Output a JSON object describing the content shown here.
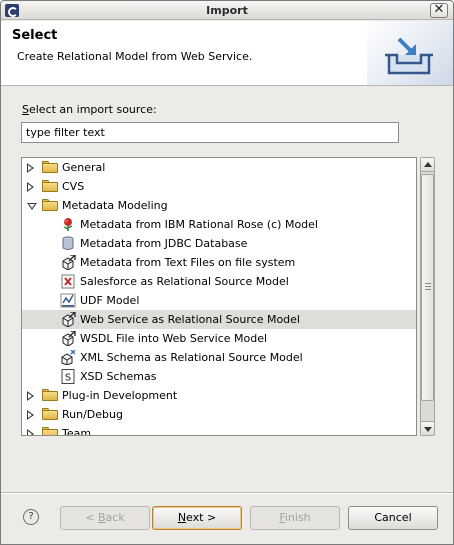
{
  "window": {
    "title": "Import"
  },
  "header": {
    "title": "Select",
    "description": "Create Relational Model from Web Service."
  },
  "source": {
    "label": "Select an import source:",
    "label_mnemonic": "S",
    "label_rest": "elect an import source:",
    "filter_value": "type filter text"
  },
  "tree": {
    "items": [
      {
        "label": "General",
        "level": 0,
        "state": "collapsed",
        "icon": "folder-icon"
      },
      {
        "label": "CVS",
        "level": 0,
        "state": "collapsed",
        "icon": "folder-icon"
      },
      {
        "label": "Metadata Modeling",
        "level": 0,
        "state": "expanded",
        "icon": "folder-icon"
      },
      {
        "label": "Metadata from IBM Rational Rose (c) Model",
        "level": 1,
        "icon": "rose-icon"
      },
      {
        "label": "Metadata from JDBC Database",
        "level": 1,
        "icon": "database-icon"
      },
      {
        "label": "Metadata from Text Files on file system",
        "level": 1,
        "icon": "cube-arrow-icon"
      },
      {
        "label": "Salesforce as Relational Source Model",
        "level": 1,
        "icon": "salesforce-icon"
      },
      {
        "label": "UDF Model",
        "level": 1,
        "icon": "udf-icon"
      },
      {
        "label": "Web Service as Relational Source Model",
        "level": 1,
        "icon": "cube-arrow-icon",
        "selected": true
      },
      {
        "label": "WSDL File into Web Service Model",
        "level": 1,
        "icon": "cube-arrow-icon"
      },
      {
        "label": "XML Schema as Relational Source Model",
        "level": 1,
        "icon": "xml-cube-icon"
      },
      {
        "label": "XSD Schemas",
        "level": 1,
        "icon": "xsd-icon"
      },
      {
        "label": "Plug-in Development",
        "level": 0,
        "state": "collapsed",
        "icon": "folder-icon"
      },
      {
        "label": "Run/Debug",
        "level": 0,
        "state": "collapsed",
        "icon": "folder-icon"
      },
      {
        "label": "Team",
        "level": 0,
        "state": "collapsed",
        "icon": "folder-icon"
      }
    ]
  },
  "footer": {
    "help": "?",
    "back_mnemonic": "B",
    "back_rest": "ack",
    "back_prefix": "< ",
    "next_mnemonic": "N",
    "next_rest": "ext >",
    "finish_mnemonic": "F",
    "finish_rest": "inish",
    "cancel": "Cancel",
    "back_enabled": false,
    "next_enabled": true,
    "finish_enabled": false
  }
}
